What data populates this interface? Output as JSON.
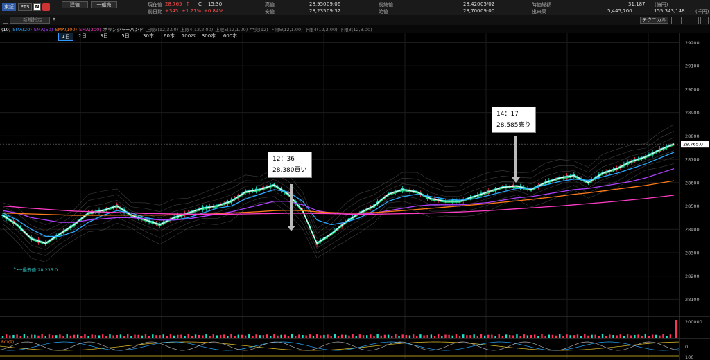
{
  "header": {
    "market_button": "東証",
    "pts_button": "PTS",
    "n_badge": "N",
    "select_label": "建値",
    "order_button": "一般売",
    "current_label": "現在値",
    "current_value": "28,765",
    "current_arrow": "↑",
    "c_mark": "C",
    "current_time": "15:30",
    "change_label": "前日比",
    "change_value": "+345",
    "change_pct": "+1.21%",
    "change_pct2": "+0.84%",
    "high_label": "高値",
    "high_value": "28,950",
    "high_time": "09:06",
    "low_label": "安値",
    "low_value": "28,235",
    "low_time": "09:32",
    "prev_label": "前終値",
    "prev_value": "28,420",
    "prev_date": "05/02",
    "open_label": "始値",
    "open_value": "28,700",
    "open_time": "09:00",
    "mcap_label": "時価総額",
    "mcap_value": "31,187",
    "mcap_unit": "(億円)",
    "volume_label": "出来高",
    "volume_value": "5,445,700",
    "turnover_value": "155,343,148",
    "turnover_unit": "(千円)",
    "technical_button": "テクニカル"
  },
  "toolbar": {
    "new_order_label": "新規指定",
    "periods": [
      "1日",
      "2日",
      "3日",
      "5日",
      "30本",
      "60本",
      "100本",
      "300本",
      "600本"
    ],
    "active_period": "1日"
  },
  "legend": {
    "items": [
      {
        "text": "(10)",
        "color": "#ffffff"
      },
      {
        "text": "SMA(20)",
        "color": "#28a8ff"
      },
      {
        "text": "SMA(50)",
        "color": "#b040ff"
      },
      {
        "text": "SMA(100)",
        "color": "#ff7a1a"
      },
      {
        "text": "SMA(200)",
        "color": "#ff3cc8"
      },
      {
        "text": "ボリンジャーバンド",
        "color": "#dddddd"
      },
      {
        "text": "上限3(12,3.00)",
        "color": "#888888"
      },
      {
        "text": "上限4(12,2.00)",
        "color": "#888888"
      },
      {
        "text": "上限5(12,1.00)",
        "color": "#888888"
      },
      {
        "text": "中央(12)",
        "color": "#888888"
      },
      {
        "text": "下限5(12,1.00)",
        "color": "#888888"
      },
      {
        "text": "下限4(12,2.00)",
        "color": "#888888"
      },
      {
        "text": "下限3(12,3.00)",
        "color": "#888888"
      }
    ]
  },
  "annotations": {
    "buy_time": "12：36",
    "buy_text": "28,380買い",
    "sell_time": "14：17",
    "sell_text": "28,585売り",
    "low_marker": "一最安値:28,235.0",
    "last_price_tag": "28,765.0"
  },
  "volume_axis_label": "200000",
  "osc_labels": {
    "zero": "0",
    "hundred": "100",
    "name": "RCI(9)"
  },
  "colors": {
    "up_candle": "#1ee0c8",
    "down_candle": "#ff3355",
    "price_axis_bg": "#000000",
    "current_price": "#ff4d4d"
  },
  "chart_data": {
    "type": "line",
    "title": "",
    "ylabel": "",
    "yticks": [
      28100,
      28200,
      28300,
      28400,
      28500,
      28600,
      28700,
      28800,
      28900,
      29000,
      29100,
      29200
    ],
    "ylim": [
      28030,
      29240
    ],
    "grid": true,
    "series": [
      {
        "name": "",
        "values": [
          28460,
          28420,
          28360,
          28340,
          28380,
          28420,
          28470,
          28480,
          28500,
          28460,
          28440,
          28420,
          28450,
          28470,
          28490,
          28500,
          28520,
          28560,
          28570,
          28590,
          28550,
          28480,
          28340,
          28380,
          28430,
          28470,
          28500,
          28550,
          28570,
          28560,
          28530,
          28520,
          28520,
          28540,
          28560,
          28580,
          28585,
          28570,
          28600,
          28620,
          28630,
          28600,
          28640,
          28660,
          28690,
          28710,
          28740,
          28765
        ]
      },
      {
        "name": "SMA(20)",
        "values": [
          28470,
          28440,
          28400,
          28370,
          28370,
          28390,
          28430,
          28460,
          28480,
          28470,
          28450,
          28440,
          28440,
          28450,
          28470,
          28490,
          28500,
          28530,
          28550,
          28570,
          28560,
          28520,
          28440,
          28420,
          28430,
          28450,
          28480,
          28520,
          28540,
          28550,
          28540,
          28530,
          28525,
          28530,
          28545,
          28560,
          28575,
          28575,
          28590,
          28605,
          28615,
          28610,
          28625,
          28640,
          28660,
          28680,
          28705,
          28730
        ]
      },
      {
        "name": "SMA(50)",
        "values": [
          28480,
          28470,
          28450,
          28440,
          28430,
          28430,
          28440,
          28445,
          28450,
          28450,
          28445,
          28440,
          28440,
          28445,
          28455,
          28465,
          28475,
          28490,
          28505,
          28520,
          28520,
          28505,
          28480,
          28470,
          28465,
          28465,
          28470,
          28480,
          28490,
          28500,
          28505,
          28505,
          28505,
          28510,
          28515,
          28525,
          28535,
          28540,
          28550,
          28560,
          28570,
          28575,
          28585,
          28595,
          28605,
          28620,
          28640,
          28660
        ]
      },
      {
        "name": "SMA(100)",
        "values": [
          28470,
          28468,
          28466,
          28464,
          28462,
          28460,
          28460,
          28460,
          28461,
          28461,
          28461,
          28461,
          28462,
          28463,
          28465,
          28467,
          28470,
          28473,
          28476,
          28480,
          28482,
          28480,
          28475,
          28472,
          28470,
          28470,
          28472,
          28476,
          28480,
          28485,
          28490,
          28495,
          28500,
          28505,
          28510,
          28516,
          28522,
          28528,
          28535,
          28542,
          28550,
          28556,
          28564,
          28572,
          28580,
          28588,
          28598,
          28608
        ]
      },
      {
        "name": "SMA(200)",
        "values": [
          28500,
          28495,
          28490,
          28486,
          28482,
          28478,
          28476,
          28474,
          28472,
          28470,
          28468,
          28467,
          28466,
          28465,
          28465,
          28465,
          28465,
          28466,
          28467,
          28468,
          28469,
          28469,
          28468,
          28467,
          28466,
          28465,
          28465,
          28466,
          28467,
          28468,
          28470,
          28472,
          28474,
          28477,
          28480,
          28484,
          28488,
          28492,
          28496,
          28500,
          28505,
          28510,
          28515,
          28520,
          28526,
          28532,
          28539,
          28546
        ]
      }
    ]
  }
}
